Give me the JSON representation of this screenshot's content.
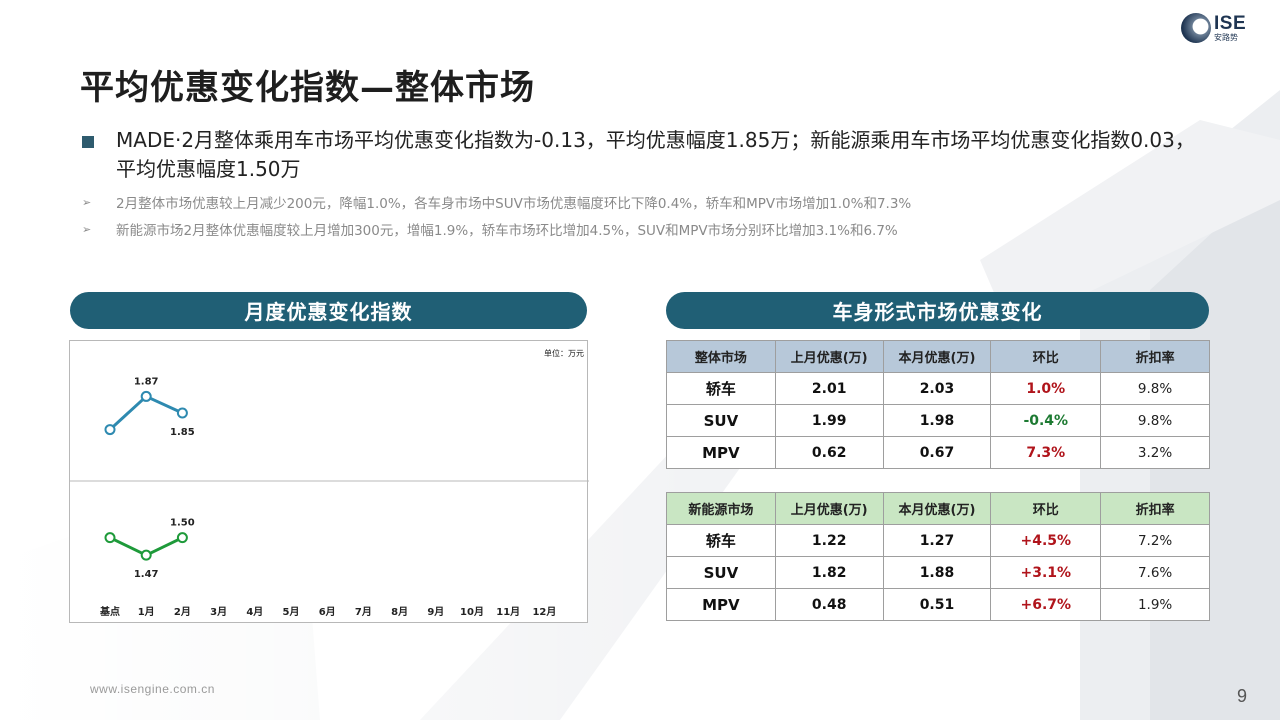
{
  "brand": {
    "logo_text": "ISE",
    "logo_sub": "安路势"
  },
  "title": "平均优惠变化指数—整体市场",
  "main_bullet": "MADE·2月整体乘用车市场平均优惠变化指数为-0.13，平均优惠幅度1.85万；新能源乘用车市场平均优惠变化指数0.03，平均优惠幅度1.50万",
  "sub_bullets": [
    "2月整体市场优惠较上月减少200元，降幅1.0%，各车身市场中SUV市场优惠幅度环比下降0.4%，轿车和MPV市场增加1.0%和7.3%",
    "新能源市场2月整体优惠幅度较上月增加300元，增幅1.9%，轿车市场环比增加4.5%，SUV和MPV市场分别环比增加3.1%和6.7%"
  ],
  "left_panel": {
    "header": "月度优惠变化指数"
  },
  "right_panel": {
    "header": "车身形式市场优惠变化"
  },
  "chart_data": {
    "type": "line",
    "unit_label": "单位：万元",
    "categories": [
      "基点",
      "1月",
      "2月",
      "3月",
      "4月",
      "5月",
      "6月",
      "7月",
      "8月",
      "9月",
      "10月",
      "11月",
      "12月"
    ],
    "series": [
      {
        "values": [
          1.83,
          1.87,
          1.85
        ],
        "labels": [
          "",
          "1.87",
          "1.85"
        ],
        "color": "#2e8ab0"
      },
      {
        "values": [
          1.5,
          1.47,
          1.5
        ],
        "labels": [
          "",
          "1.47",
          "1.50"
        ],
        "color": "#1e9a3a"
      }
    ]
  },
  "table_overall": {
    "headers": [
      "整体市场",
      "上月优惠(万)",
      "本月优惠(万)",
      "环比",
      "折扣率"
    ],
    "rows": [
      [
        "轿车",
        "2.01",
        "2.03",
        "1.0%",
        "9.8%"
      ],
      [
        "SUV",
        "1.99",
        "1.98",
        "-0.4%",
        "9.8%"
      ],
      [
        "MPV",
        "0.62",
        "0.67",
        "7.3%",
        "3.2%"
      ]
    ]
  },
  "table_nev": {
    "headers": [
      "新能源市场",
      "上月优惠(万)",
      "本月优惠(万)",
      "环比",
      "折扣率"
    ],
    "rows": [
      [
        "轿车",
        "1.22",
        "1.27",
        "+4.5%",
        "7.2%"
      ],
      [
        "SUV",
        "1.82",
        "1.88",
        "+3.1%",
        "7.6%"
      ],
      [
        "MPV",
        "0.48",
        "0.51",
        "+6.7%",
        "1.9%"
      ]
    ]
  },
  "colors": {
    "accent": "#205f75",
    "positive": "#b0141b",
    "negative": "#1d7a32"
  },
  "footer": {
    "url": "www.isengine.com.cn",
    "page": "9"
  }
}
